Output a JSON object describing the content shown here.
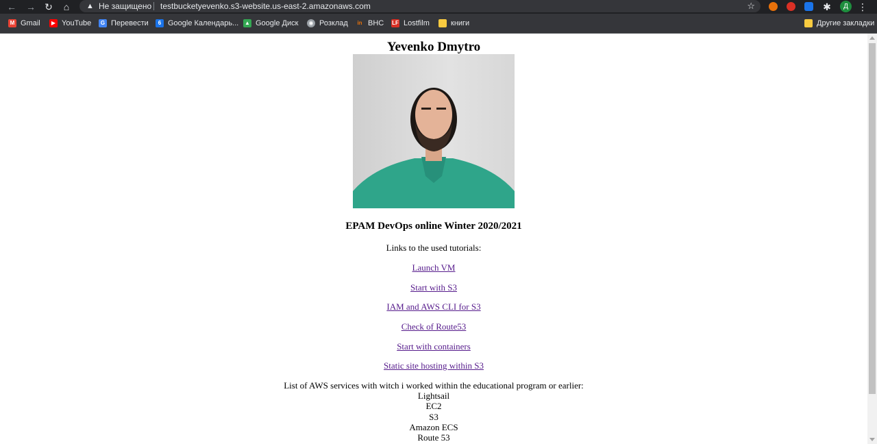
{
  "browser": {
    "security_label": "Не защищено",
    "url": "testbucketyevenko.s3-website.us-east-2.amazonaws.com",
    "profile_initial": "Д",
    "bookmarks": [
      {
        "label": "Gmail",
        "icon": "gmail-icon",
        "color": "#ea4335",
        "glyph": "M"
      },
      {
        "label": "YouTube",
        "icon": "youtube-icon",
        "color": "#ff0000",
        "glyph": "▶"
      },
      {
        "label": "Перевести",
        "icon": "translate-icon",
        "color": "#4285f4",
        "glyph": "G"
      },
      {
        "label": "Google Календарь...",
        "icon": "calendar-icon",
        "color": "#1a73e8",
        "glyph": "6"
      },
      {
        "label": "Google Диск",
        "icon": "drive-icon",
        "color": "#34a853",
        "glyph": "▲"
      },
      {
        "label": "Розклад",
        "icon": "globe-icon",
        "color": "#9aa0a6",
        "glyph": "◉"
      },
      {
        "label": "ВНС",
        "icon": "vns-icon",
        "color": "#e8710a",
        "glyph": "in"
      },
      {
        "label": "Lostfilm",
        "icon": "lostfilm-icon",
        "color": "#d93025",
        "glyph": "LF"
      },
      {
        "label": "книги",
        "icon": "folder-icon",
        "color": "#f9cb40",
        "glyph": ""
      }
    ],
    "other_bookmarks": "Другие закладки"
  },
  "page": {
    "title": "Yevenko Dmytro",
    "subtitle": "EPAM DevOps online Winter 2020/2021",
    "links_intro": "Links to the used tutorials:",
    "links": [
      "Launch VM",
      "Start with S3",
      "IAM and AWS CLI for S3",
      "Check of Route53",
      "Start with containers",
      "Static site hosting within S3"
    ],
    "services_intro": "List of AWS services with witch i worked within the educational program or earlier:",
    "services": [
      "Lightsail",
      "EC2",
      "S3",
      "Amazon ECS",
      "Route 53"
    ]
  }
}
